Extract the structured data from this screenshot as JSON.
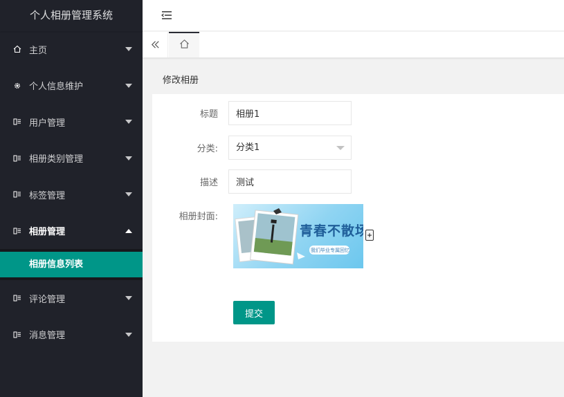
{
  "app": {
    "title": "个人相册管理系统"
  },
  "sidebar": {
    "items": [
      {
        "label": "主页",
        "icon": "home-icon"
      },
      {
        "label": "个人信息维护",
        "icon": "gear-icon"
      },
      {
        "label": "用户管理",
        "icon": "list-icon"
      },
      {
        "label": "相册类别管理",
        "icon": "list-icon"
      },
      {
        "label": "标签管理",
        "icon": "list-icon"
      },
      {
        "label": "相册管理",
        "icon": "list-icon",
        "open": true
      },
      {
        "label": "评论管理",
        "icon": "list-icon"
      },
      {
        "label": "消息管理",
        "icon": "list-icon"
      }
    ],
    "submenu": {
      "label": "相册信息列表"
    }
  },
  "tabs": {
    "home_icon": "home-icon",
    "prev_icon": "double-chevron-left-icon"
  },
  "form": {
    "header": "修改相册",
    "title_label": "标题",
    "title_value": "相册1",
    "category_label": "分类:",
    "category_value": "分类1",
    "desc_label": "描述",
    "desc_value": "测试",
    "cover_label": "相册封面:",
    "cover_text": "青春不散场",
    "cover_subtext": "我们毕业专属回忆",
    "plus_label": "+",
    "submit_label": "提交"
  },
  "colors": {
    "sidebar_bg": "#20222a",
    "accent": "#009688",
    "page_bg": "#f2f2f2"
  }
}
